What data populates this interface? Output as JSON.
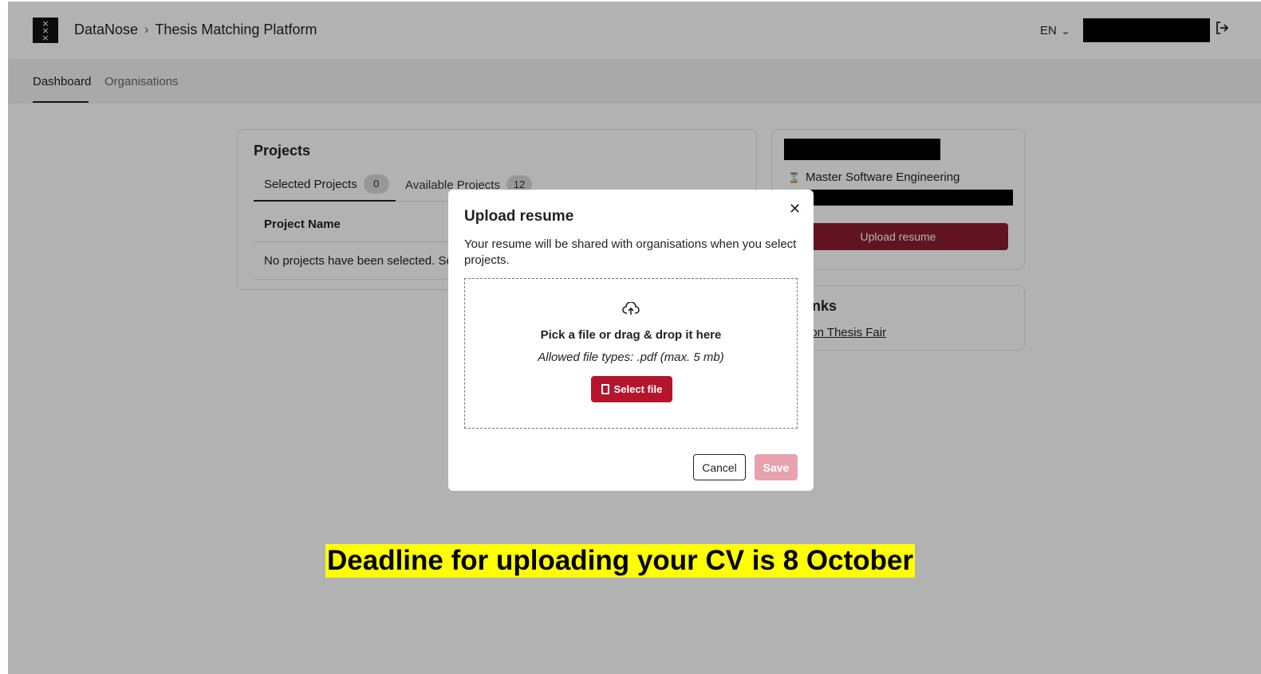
{
  "header": {
    "logo_text": "×\n×\n×",
    "breadcrumb": [
      "DataNose",
      "Thesis Matching Platform"
    ],
    "breadcrumb_separator": "›",
    "language": "EN",
    "logout_icon": "↪"
  },
  "nav": {
    "tabs": [
      {
        "label": "Dashboard",
        "active": true
      },
      {
        "label": "Organisations",
        "active": false
      }
    ]
  },
  "projects": {
    "title": "Projects",
    "tabs": [
      {
        "label": "Selected Projects",
        "count": "0"
      },
      {
        "label": "Available Projects",
        "count": "12"
      }
    ],
    "column_header": "Project Name",
    "empty_message": "No projects have been selected. Sele"
  },
  "profile": {
    "program_icon": "⌛",
    "program": "Master Software Engineering",
    "upload_button": "Upload resume"
  },
  "quicklinks": {
    "title": "cklinks",
    "link": "mation Thesis Fair"
  },
  "modal": {
    "title": "Upload resume",
    "close_icon": "✕",
    "description": "Your resume will be shared with organisations when you select projects.",
    "dropzone": {
      "icon": "☁",
      "title": "Pick a file or drag & drop it here",
      "hint": "Allowed file types: .pdf (max. 5 mb)",
      "select_button": "Select file"
    },
    "cancel_button": "Cancel",
    "save_button": "Save"
  },
  "annotation": {
    "deadline_text": "Deadline for uploading your CV is 8 October"
  },
  "colors": {
    "brand_red": "#b5142d",
    "dark_red": "#8c1d2e",
    "save_disabled": "#e8a2ae",
    "highlight": "#ffff00"
  }
}
